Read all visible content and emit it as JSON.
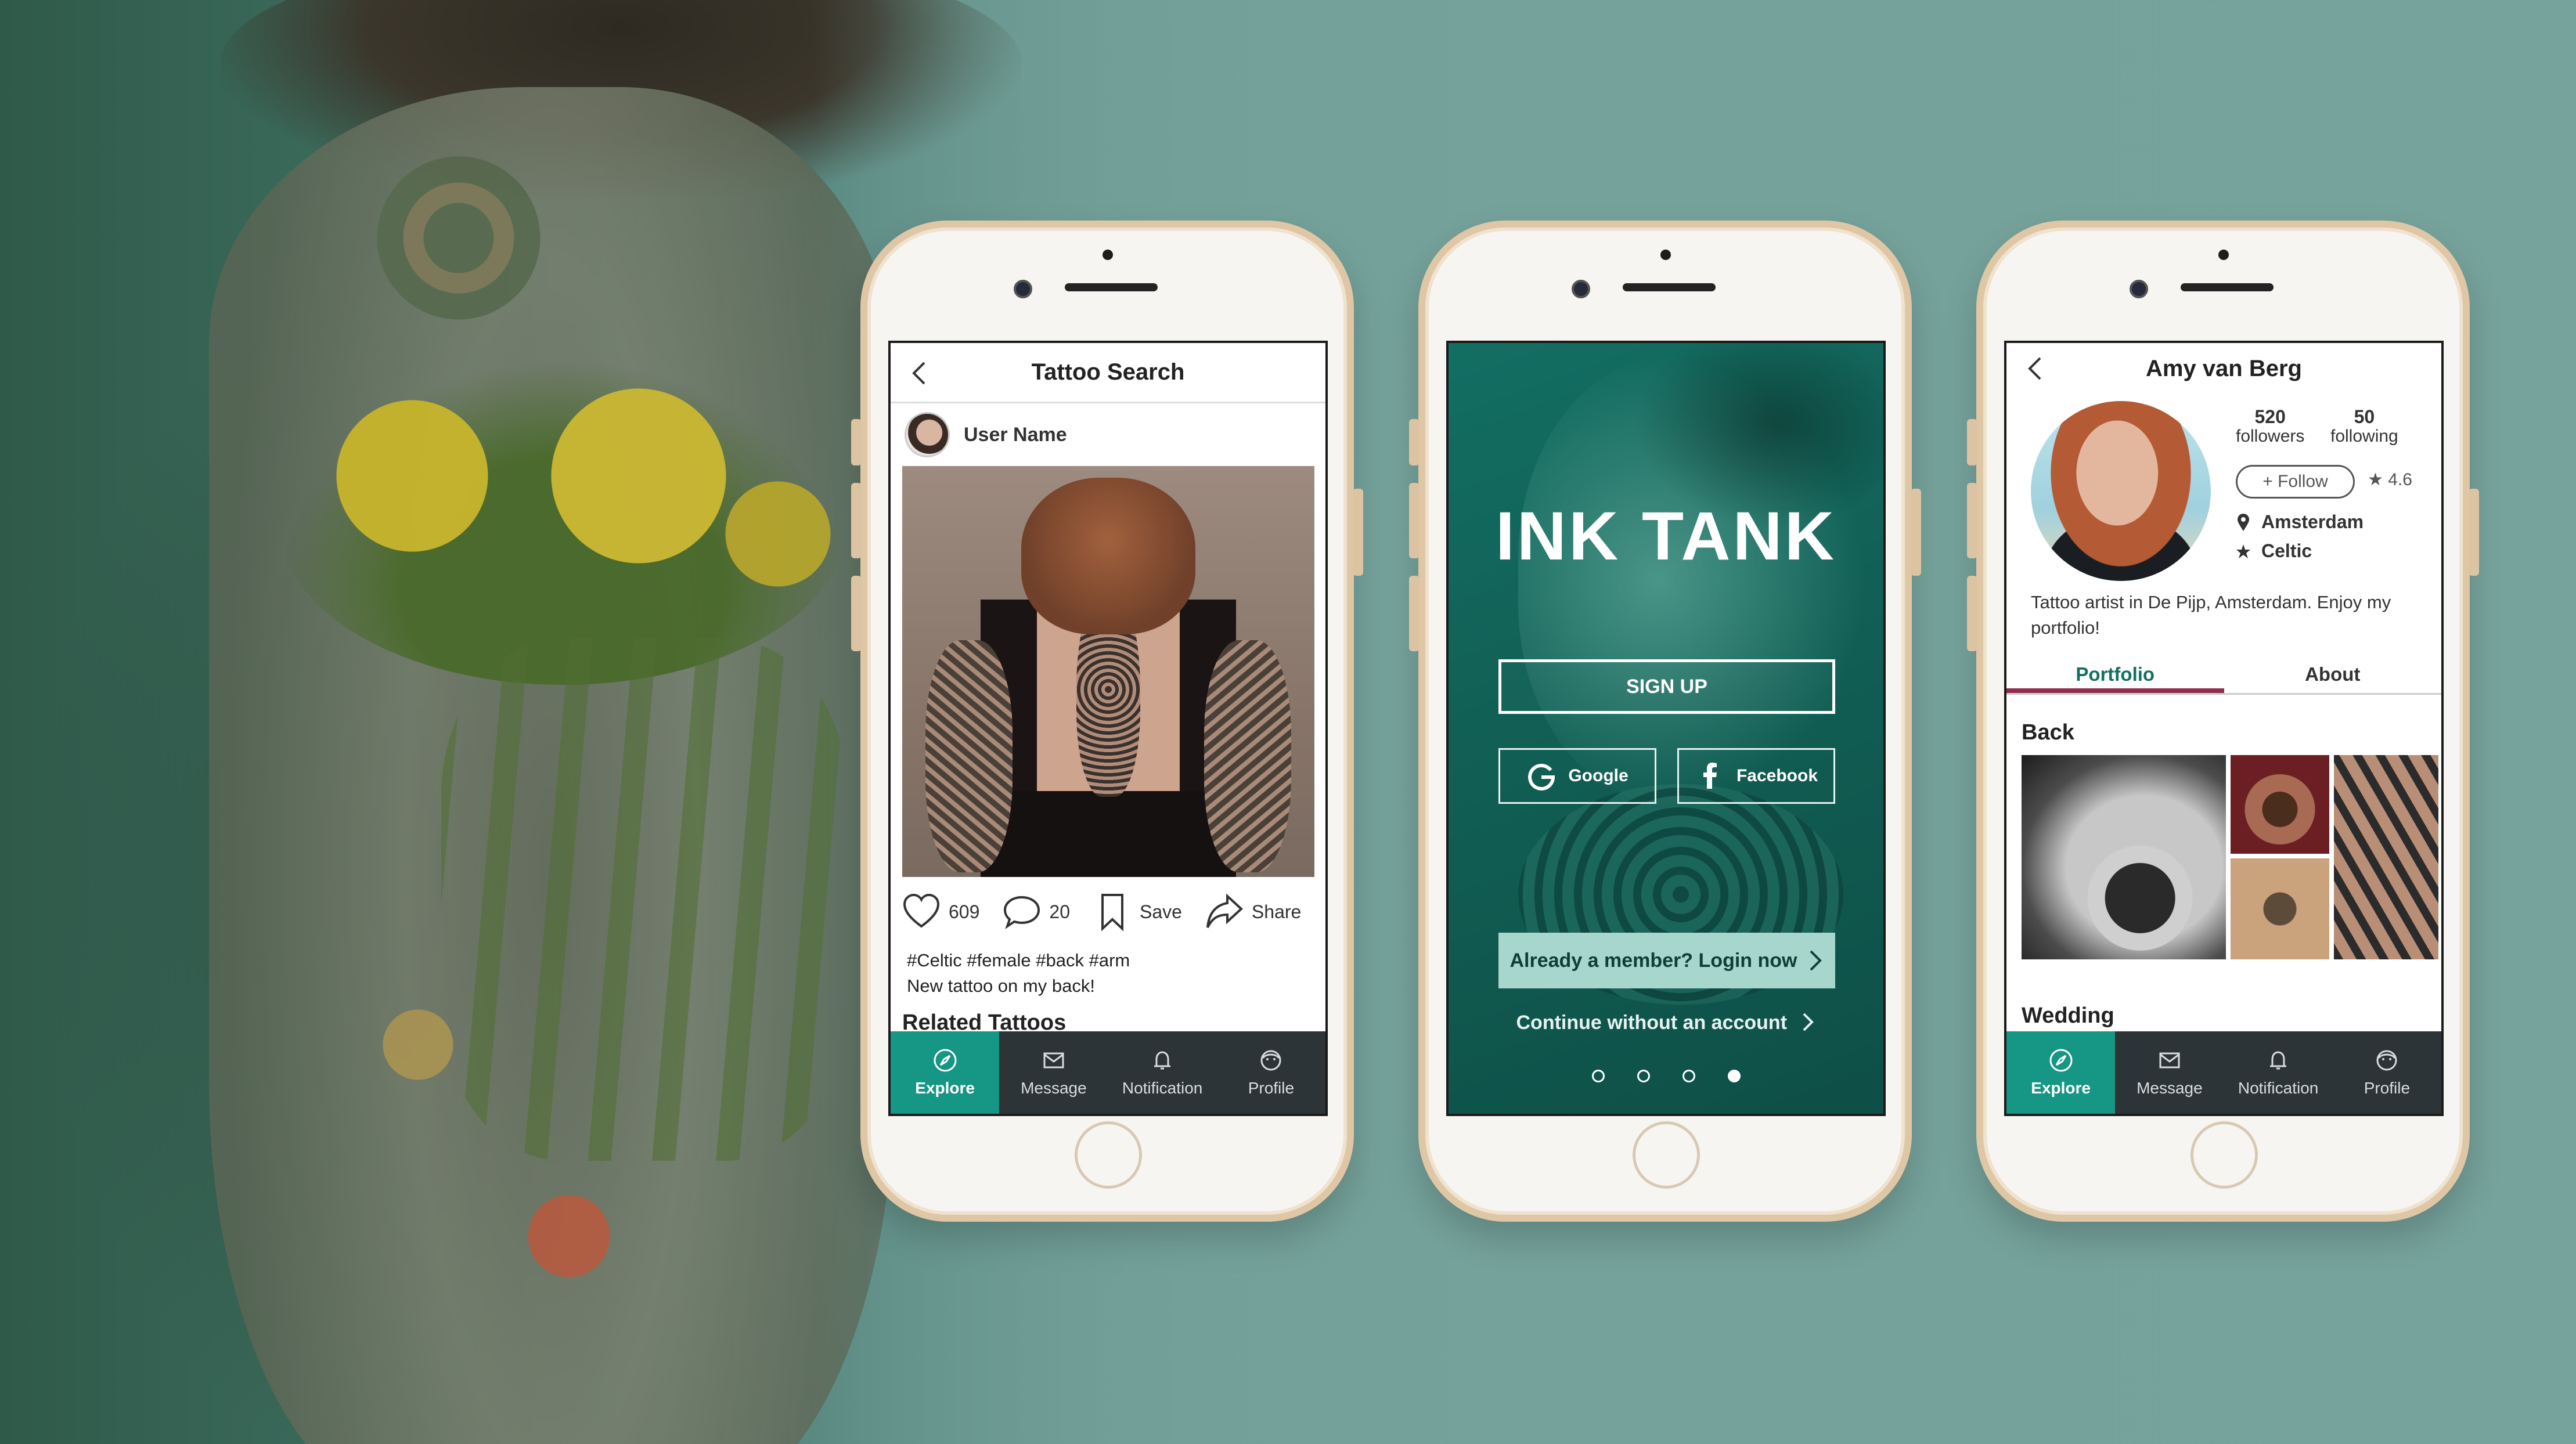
{
  "app": {
    "name": "INK TANK"
  },
  "colors": {
    "accent": "#169685",
    "brand_dark": "#136e62",
    "nav_bg": "#2c3438",
    "tab_underline": "#8d2f4c"
  },
  "bottom_nav": {
    "items": [
      {
        "label": "Explore",
        "icon": "compass-icon",
        "active": true
      },
      {
        "label": "Message",
        "icon": "envelope-icon"
      },
      {
        "label": "Notification",
        "icon": "bell-icon"
      },
      {
        "label": "Profile",
        "icon": "face-icon"
      }
    ]
  },
  "screen1": {
    "title": "Tattoo Search",
    "user_name": "User Name",
    "likes": "609",
    "comments": "20",
    "save_label": "Save",
    "share_label": "Share",
    "caption_tags": "#Celtic #female #back #arm",
    "caption_text": "New tattoo on my back!",
    "related_heading": "Related Tattoos"
  },
  "screen2": {
    "brand": "INK TANK",
    "signup": "SIGN UP",
    "google": "Google",
    "facebook": "Facebook",
    "login": "Already a member? Login now",
    "continue": "Continue without an account",
    "carousel": {
      "pages": 4,
      "active_index": 3
    }
  },
  "screen3": {
    "name": "Amy van Berg",
    "followers_count": "520",
    "followers_label": "followers",
    "following_count": "50",
    "following_label": "following",
    "follow_button": "+ Follow",
    "rating": "4.6",
    "location": "Amsterdam",
    "style": "Celtic",
    "bio": "Tattoo artist in De Pijp, Amsterdam. Enjoy my portfolio!",
    "tabs": [
      {
        "label": "Portfolio",
        "active": true
      },
      {
        "label": "About"
      }
    ],
    "section_back": "Back",
    "section_wedding": "Wedding"
  }
}
